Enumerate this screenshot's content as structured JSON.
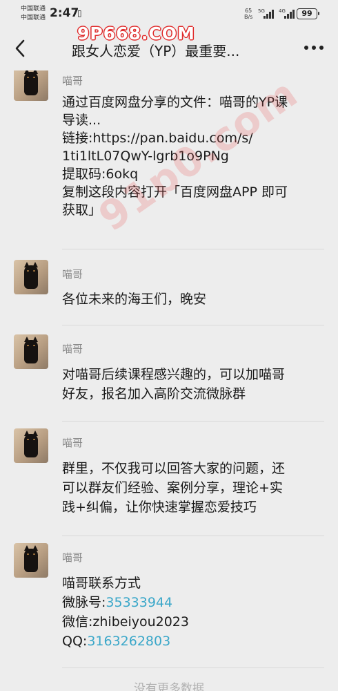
{
  "status_bar": {
    "carrier_1": "中国联通",
    "carrier_2": "中国联通",
    "time": "2:47",
    "net_speed_value": "65",
    "net_speed_unit": "B/s",
    "sim1_tag": "5G",
    "sim2_tag": "4G",
    "battery": "99"
  },
  "watermark": {
    "text": "9P668.COM"
  },
  "nav": {
    "title": "跟女人恋爱（YP）最重要..."
  },
  "messages": [
    {
      "sender": "喵哥",
      "lines": [
        {
          "text": "通过百度网盘分享的文件：喵哥的YP课"
        },
        {
          "text": "导读..."
        },
        {
          "text": "链接:https://pan.baidu.com/s/"
        },
        {
          "text": "1ti1ltL07QwY-lgrb1o9PNg"
        },
        {
          "text": "提取码:6okq"
        },
        {
          "text": "复制这段内容打开「百度网盘APP 即可"
        },
        {
          "text": "获取」"
        }
      ]
    },
    {
      "sender": "喵哥",
      "lines": [
        {
          "text": "各位未来的海王们，晚安"
        }
      ]
    },
    {
      "sender": "喵哥",
      "lines": [
        {
          "text": "对喵哥后续课程感兴趣的，可以加喵哥"
        },
        {
          "text": "好友，报名加入高阶交流微脉群"
        }
      ]
    },
    {
      "sender": "喵哥",
      "lines": [
        {
          "text": "群里，不仅我可以回答大家的问题，还"
        },
        {
          "text": "可以群友们经验、案例分享，理论+实"
        },
        {
          "text": "践+纠偏，让你快速掌握恋爱技巧"
        }
      ]
    },
    {
      "sender": "喵哥",
      "lines": [
        {
          "text": "喵哥联系方式"
        },
        {
          "label": "微脉号:",
          "link": "35333944"
        },
        {
          "text": "微信:zhibeiyou2023"
        },
        {
          "label": "QQ:",
          "link": "3163262803"
        }
      ]
    }
  ],
  "footer": {
    "no_more": "没有更多数据"
  },
  "colors": {
    "background": "#ededed",
    "link": "#3aa7c9",
    "sender": "#888888",
    "watermark": "#e02b2b"
  }
}
